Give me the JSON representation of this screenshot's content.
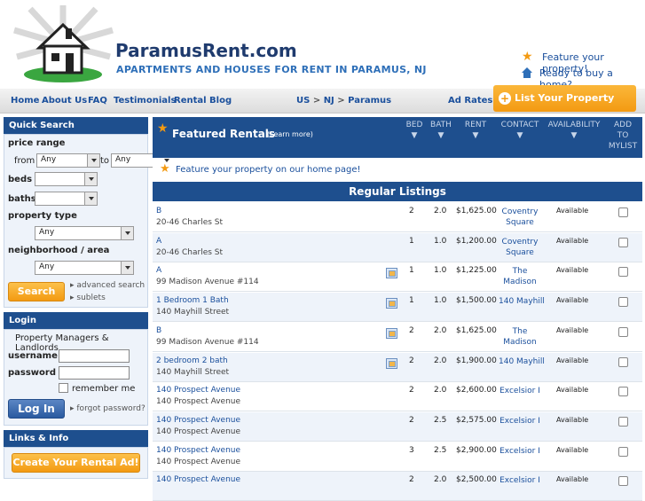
{
  "header": {
    "site_title": "ParamusRent.com",
    "tagline": "APARTMENTS AND HOUSES FOR RENT IN PARAMUS, NJ",
    "feature_property": "Feature your property!",
    "ready_to_buy": "Ready to buy a home?"
  },
  "nav": {
    "items": [
      "Home",
      "About Us",
      "FAQ",
      "Testimonials",
      "Rental Blog"
    ],
    "breadcrumb": [
      "US",
      "NJ",
      "Paramus"
    ],
    "breadcrumb_sep": ">",
    "ad_rates": "Ad Rates",
    "list_property": "List Your Property HERE!"
  },
  "quick_search": {
    "title": "Quick Search",
    "price_range": "price range",
    "from": "from",
    "to": "to",
    "from_value": "Any",
    "to_value": "Any",
    "beds": "beds",
    "baths": "baths",
    "property_type": "property type",
    "property_type_value": "Any",
    "neighborhood": "neighborhood / area",
    "neighborhood_value": "Any",
    "search_button": "Search",
    "advanced_search": "advanced search",
    "sublets": "sublets"
  },
  "login": {
    "title": "Login",
    "subtitle": "Property Managers & Landlords",
    "username": "username",
    "password": "password",
    "remember": "remember me",
    "login_button": "Log In",
    "forgot": "forgot password?"
  },
  "links_info": {
    "title": "Links & Info",
    "create_ad": "Create Your Rental Ad!"
  },
  "featured": {
    "title": "Featured Rentals",
    "learn_more": "(Learn more)",
    "columns": {
      "bed": "BED",
      "bath": "BATH",
      "rent": "RENT",
      "contact": "CONTACT",
      "availability": "AVAILABILITY",
      "add1": "ADD",
      "add2": "TO",
      "add3": "MYLIST"
    },
    "feature_home": "Feature your property on our home page!"
  },
  "regular": {
    "title": "Regular Listings",
    "rows": [
      {
        "name": "B",
        "address": "20-46 Charles St",
        "bed": "2",
        "bath": "2.0",
        "rent": "$1,625.00",
        "contact1": "Coventry",
        "contact2": "Square",
        "avail": "Available",
        "photo": false
      },
      {
        "name": "A",
        "address": "20-46 Charles St",
        "bed": "1",
        "bath": "1.0",
        "rent": "$1,200.00",
        "contact1": "Coventry",
        "contact2": "Square",
        "avail": "Available",
        "photo": false
      },
      {
        "name": "A",
        "address": "99 Madison Avenue #114",
        "bed": "1",
        "bath": "1.0",
        "rent": "$1,225.00",
        "contact1": "The",
        "contact2": "Madison",
        "avail": "Available",
        "photo": true
      },
      {
        "name": "1 Bedroom 1 Bath",
        "address": "140 Mayhill Street",
        "bed": "1",
        "bath": "1.0",
        "rent": "$1,500.00",
        "contact1": "140 Mayhill",
        "contact2": "",
        "avail": "Available",
        "photo": true
      },
      {
        "name": "B",
        "address": "99 Madison Avenue #114",
        "bed": "2",
        "bath": "2.0",
        "rent": "$1,625.00",
        "contact1": "The",
        "contact2": "Madison",
        "avail": "Available",
        "photo": true
      },
      {
        "name": "2 bedroom 2 bath",
        "address": "140 Mayhill Street",
        "bed": "2",
        "bath": "2.0",
        "rent": "$1,900.00",
        "contact1": "140 Mayhill",
        "contact2": "",
        "avail": "Available",
        "photo": true
      },
      {
        "name": "140 Prospect Avenue",
        "address": "140 Prospect Avenue",
        "bed": "2",
        "bath": "2.0",
        "rent": "$2,600.00",
        "contact1": "Excelsior I",
        "contact2": "",
        "avail": "Available",
        "photo": false
      },
      {
        "name": "140 Prospect Avenue",
        "address": "140 Prospect Avenue",
        "bed": "2",
        "bath": "2.5",
        "rent": "$2,575.00",
        "contact1": "Excelsior I",
        "contact2": "",
        "avail": "Available",
        "photo": false
      },
      {
        "name": "140 Prospect Avenue",
        "address": "140 Prospect Avenue",
        "bed": "3",
        "bath": "2.5",
        "rent": "$2,900.00",
        "contact1": "Excelsior I",
        "contact2": "",
        "avail": "Available",
        "photo": false
      },
      {
        "name": "140 Prospect Avenue",
        "address": "",
        "bed": "2",
        "bath": "2.0",
        "rent": "$2,500.00",
        "contact1": "Excelsior I",
        "contact2": "",
        "avail": "Available",
        "photo": false
      }
    ]
  },
  "colors": {
    "brand_blue": "#1e4f8e",
    "orange": "#f39a12",
    "link": "#1a4f9c"
  }
}
